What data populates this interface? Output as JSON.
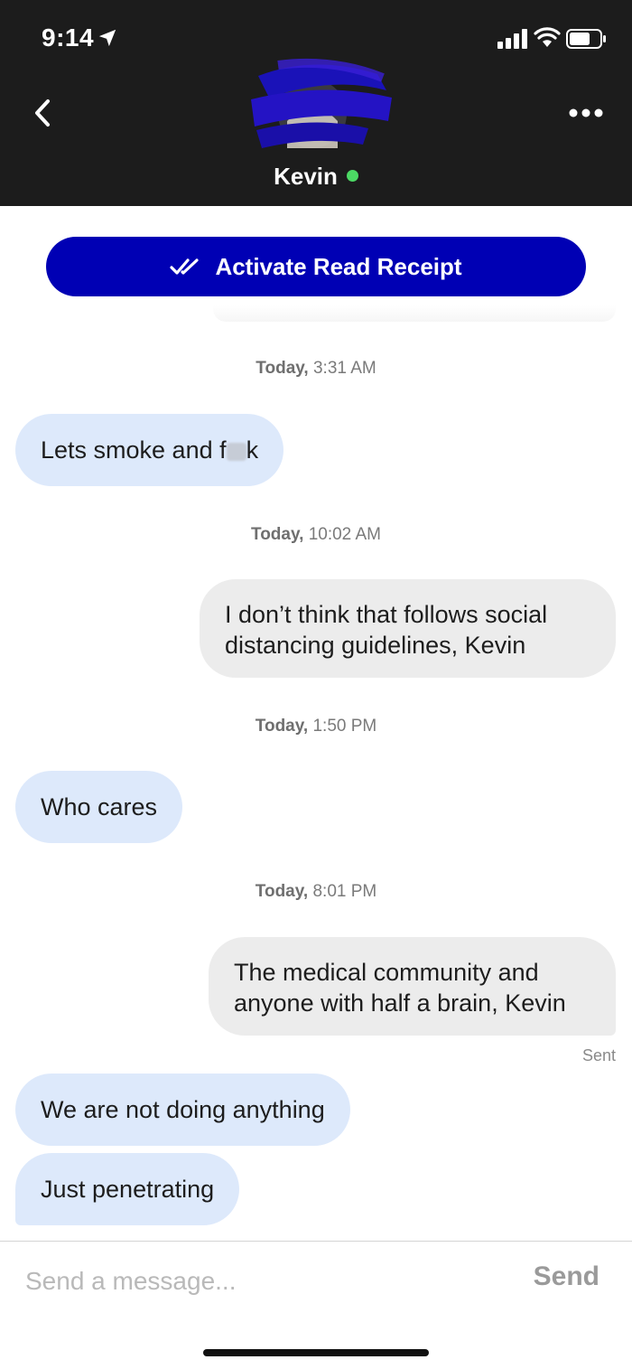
{
  "status_bar": {
    "time": "9:14"
  },
  "header": {
    "contact_name": "Kevin",
    "online": true
  },
  "read_receipt": {
    "label": "Activate Read Receipt"
  },
  "messages": [
    {
      "timestamp_day": "Today,",
      "timestamp_time": "3:31 AM",
      "direction": "in",
      "lines": [
        "Lets smoke and f",
        "k"
      ]
    },
    {
      "timestamp_day": "Today,",
      "timestamp_time": "10:02 AM",
      "direction": "out",
      "lines": [
        "I don’t think that follows social",
        "distancing guidelines, Kevin"
      ]
    },
    {
      "timestamp_day": "Today,",
      "timestamp_time": "1:50 PM",
      "direction": "in",
      "lines": [
        "Who cares"
      ]
    },
    {
      "timestamp_day": "Today,",
      "timestamp_time": "8:01 PM",
      "direction": "out",
      "lines": [
        "The medical community and",
        "anyone with half a brain, Kevin"
      ]
    },
    {
      "direction": "in",
      "lines": [
        "We are not doing anything"
      ]
    },
    {
      "direction": "in",
      "lines": [
        "Just penetrating"
      ]
    }
  ],
  "sent_label": "Sent",
  "composer": {
    "placeholder": "Send a message...",
    "send_label": "Send"
  },
  "colors": {
    "header_bg": "#1c1c1c",
    "receipt_button": "#0000b4",
    "incoming_bubble": "#dde9fb",
    "outgoing_bubble": "#ececec",
    "online_dot": "#4cd964"
  }
}
